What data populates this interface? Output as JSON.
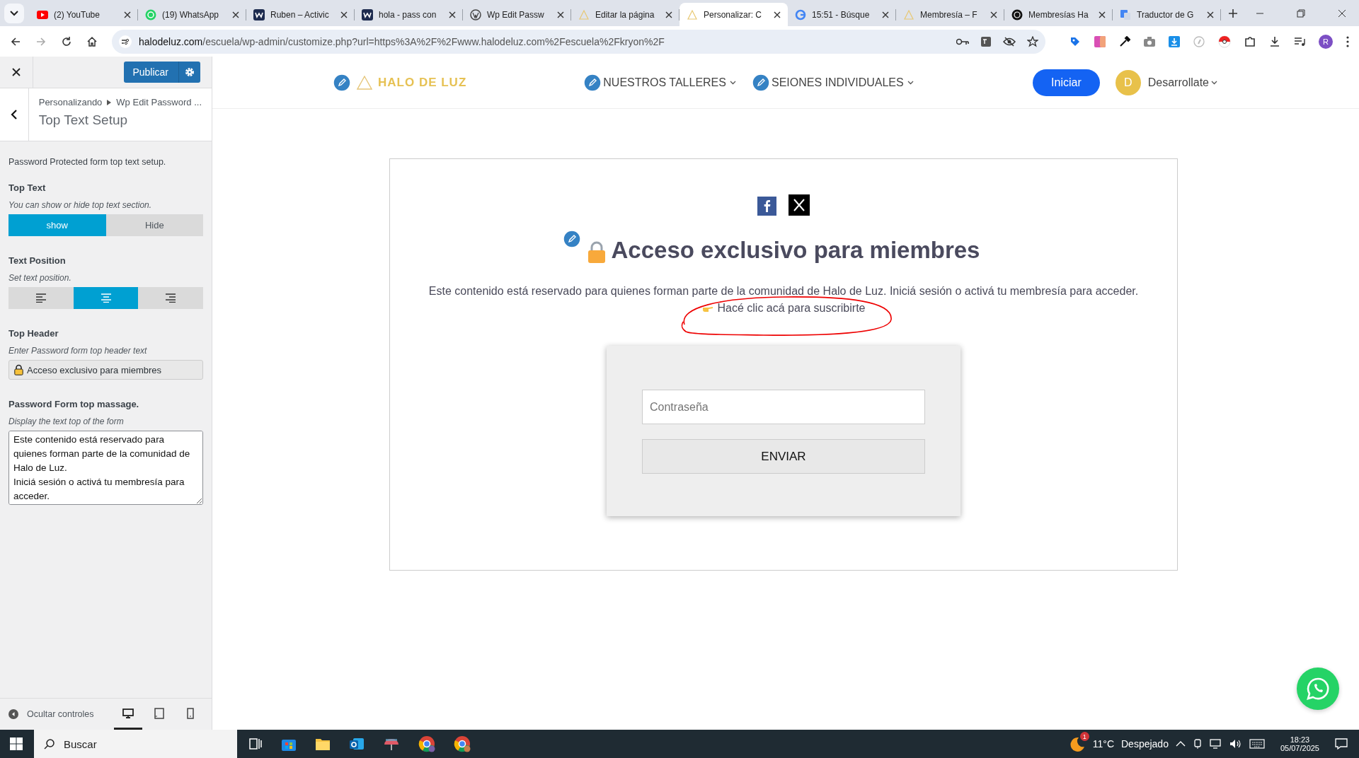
{
  "browser": {
    "tabs": [
      {
        "title": "(2) YouTube",
        "kind": "youtube",
        "selected": false
      },
      {
        "title": "(19) WhatsApp",
        "kind": "whatsapp",
        "selected": false
      },
      {
        "title": "Ruben – Activic",
        "kind": "w",
        "selected": false
      },
      {
        "title": "hola - pass con",
        "kind": "w",
        "selected": false
      },
      {
        "title": "Wp Edit Passw",
        "kind": "wordpress",
        "selected": false
      },
      {
        "title": "Editar la página",
        "kind": "halo",
        "selected": false
      },
      {
        "title": "Personalizar: C",
        "kind": "halo",
        "selected": true
      },
      {
        "title": "15:51 - Búsque",
        "kind": "google",
        "selected": false
      },
      {
        "title": "Membresía – F",
        "kind": "halo",
        "selected": false
      },
      {
        "title": "Membresías Ha",
        "kind": "circle",
        "selected": false
      },
      {
        "title": "Traductor de G",
        "kind": "translate",
        "selected": false
      }
    ],
    "url_host": "halodeluz.com",
    "url_path": "/escuela/wp-admin/customize.php?url=https%3A%2F%2Fwww.halodeluz.com%2Fescuela%2Fkryon%2F",
    "profile": "R"
  },
  "customizer": {
    "publish": "Publicar",
    "breadcrumb": [
      "Personalizando",
      "Wp Edit Password ..."
    ],
    "section_title": "Top Text Setup",
    "description": "Password Protected form top text setup.",
    "top_text": {
      "label": "Top Text",
      "hint": "You can show or hide top text section.",
      "options": [
        {
          "label": "show",
          "selected": true
        },
        {
          "label": "Hide",
          "selected": false
        }
      ]
    },
    "text_position": {
      "label": "Text Position",
      "hint": "Set text position.",
      "options": [
        {
          "kind": "left",
          "selected": false
        },
        {
          "kind": "center",
          "selected": true
        },
        {
          "kind": "right",
          "selected": false
        }
      ]
    },
    "top_header": {
      "label": "Top Header",
      "hint": "Enter Password form top header text",
      "value": "Acceso exclusivo para miembres"
    },
    "top_message": {
      "label": "Password Form top massage.",
      "hint": "Display the text top of the form",
      "value": "Este contenido está reservado para quienes forman parte de la comunidad de Halo de Luz.\nIniciá sesión o activá tu membresía para acceder."
    },
    "hide_controls": "Ocultar controles",
    "devices": [
      {
        "kind": "desktop",
        "selected": true
      },
      {
        "kind": "tablet",
        "selected": false
      },
      {
        "kind": "mobile",
        "selected": false
      }
    ]
  },
  "site": {
    "logo": "HALO DE LUZ",
    "nav": [
      "NUESTROS TALLERES",
      "SEIONES INDIVIDUALES"
    ],
    "login": "Iniciar",
    "avatar": "D",
    "user": "Desarrollate"
  },
  "form": {
    "heading": "Acceso exclusivo para miembres",
    "message": "Este contenido está reservado para quienes forman parte de la comunidad de Halo de Luz. Iniciá sesión o activá tu membresía para acceder.",
    "link": "Hacé clic acá para suscribirte",
    "password_placeholder": "Contraseña",
    "submit": "ENVIAR"
  },
  "taskbar": {
    "search": "Buscar",
    "weather_badge": "1",
    "temperature": "11°C",
    "weather": "Despejado",
    "time": "18:23",
    "date": "05/07/2025"
  }
}
